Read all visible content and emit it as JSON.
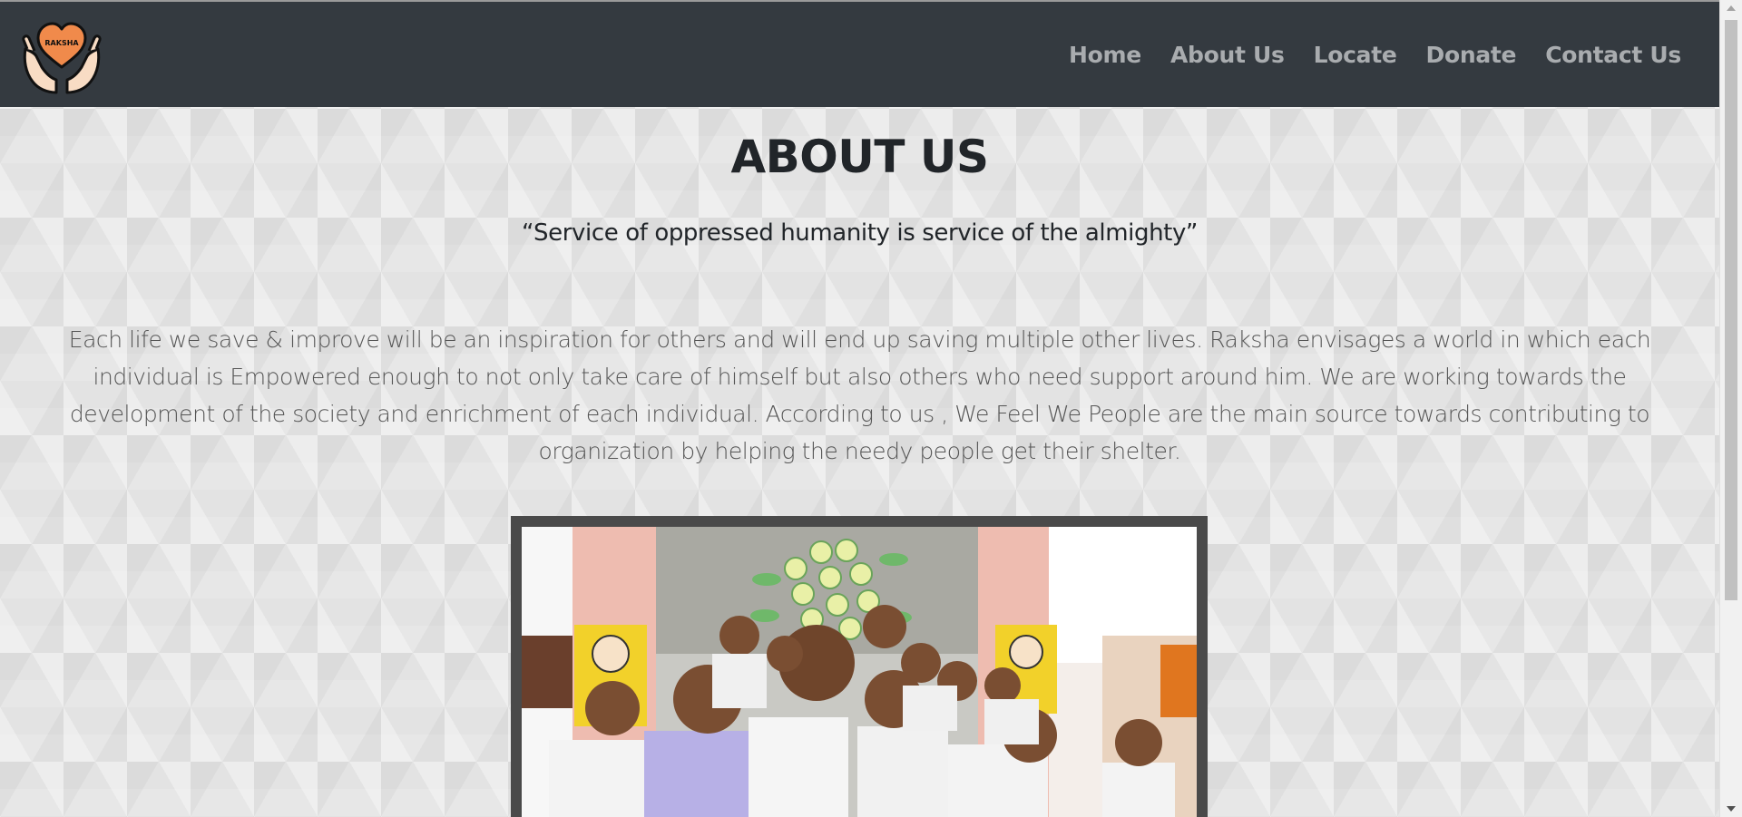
{
  "brand": {
    "logo_text": "RAKSHA",
    "logo_icon": "heart-in-hands-icon",
    "colors": {
      "heart": "#f08a4b",
      "navbar": "#343a40",
      "nav_link": "#a9acaf"
    }
  },
  "nav": {
    "items": [
      {
        "label": "Home"
      },
      {
        "label": "About Us"
      },
      {
        "label": "Locate"
      },
      {
        "label": "Donate"
      },
      {
        "label": "Contact Us"
      }
    ]
  },
  "main": {
    "title": "ABOUT US",
    "quote": "“Service of oppressed humanity is service of the almighty”",
    "description": "Each life we save & improve will be an inspiration for others and will end up saving multiple other lives. Raksha envisages a world in which each individual is Empowered enough to not only take care of himself but also others who need support around him. We are working towards the development of the society and enrichment of each individual. According to us , We Feel We People are the main source towards contributing to organization by helping the needy people get their shelter.",
    "photo": {
      "subject": "group-of-smiling-schoolchildren-photo"
    }
  }
}
